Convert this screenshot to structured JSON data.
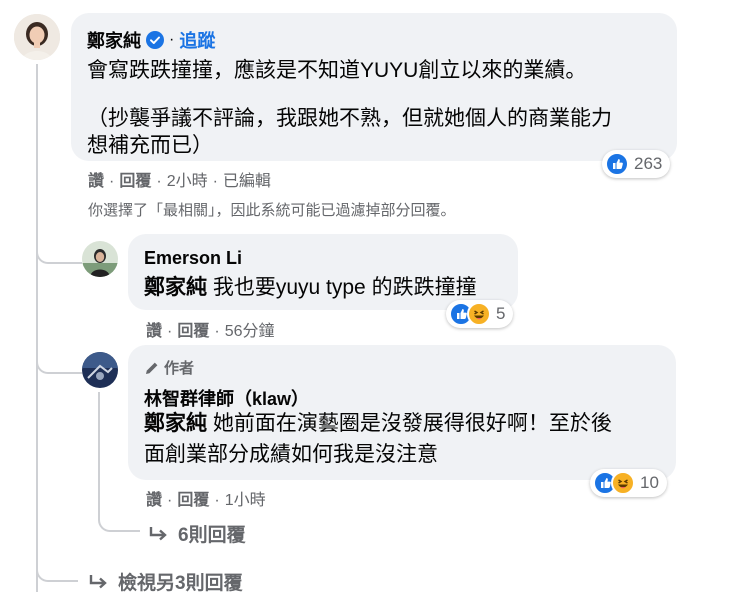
{
  "main_comment": {
    "author": "鄭家純",
    "follow_label": "追蹤",
    "line1": "會寫跌跌撞撞，應該是不知道YUYU創立以來的業績。",
    "line2a": "（抄襲爭議不評論，我跟她不熟，但就她個人的商業能力",
    "line2b": "想補充而已）",
    "reaction_count": "263",
    "actions": {
      "like": "讚",
      "reply": "回覆",
      "time": "2小時",
      "edited": "已編輯"
    },
    "filter_notice": "你選擇了「最相關」，因此系統可能已過濾掉部分回覆。"
  },
  "reply1": {
    "author": "Emerson Li",
    "mention": "鄭家純",
    "text": "我也要yuyu type 的跌跌撞撞",
    "reaction_count": "5",
    "actions": {
      "like": "讚",
      "reply": "回覆",
      "time": "56分鐘"
    }
  },
  "reply2": {
    "badge": "作者",
    "author": "林智群律師（klaw）",
    "mention": "鄭家純",
    "text1": "她前面在演藝圈是沒發展得很好啊！至於後",
    "text2": "面創業部分成績如何我是沒注意",
    "reaction_count": "10",
    "actions": {
      "like": "讚",
      "reply": "回覆",
      "time": "1小時"
    },
    "more_replies": "6則回覆"
  },
  "view_more": "檢視另3則回覆",
  "colors": {
    "accent": "#1b74e4",
    "bubble": "#f0f2f5",
    "meta": "#65676b",
    "line": "#ced0d4"
  }
}
